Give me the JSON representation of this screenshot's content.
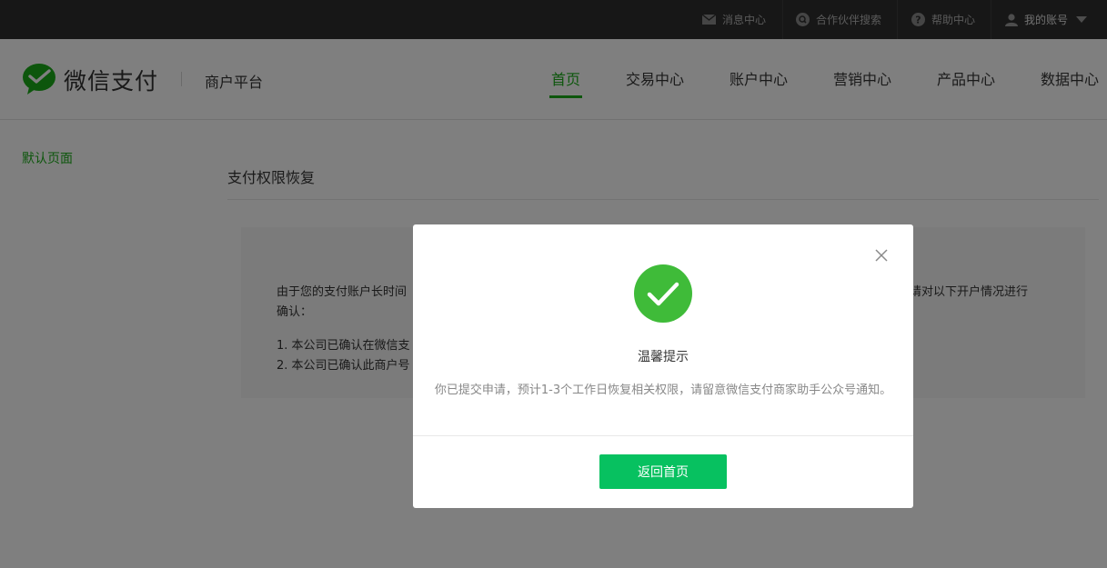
{
  "topbar": {
    "messages": "消息中心",
    "partner_search": "合作伙伴搜索",
    "help": "帮助中心",
    "account": "我的账号"
  },
  "header": {
    "brand": "微信支付",
    "platform": "商户平台",
    "nav": [
      "首页",
      "交易中心",
      "账户中心",
      "营销中心",
      "产品中心",
      "数据中心"
    ],
    "active_index": 0
  },
  "sidebar": {
    "items": [
      {
        "label": "默认页面"
      }
    ]
  },
  "main": {
    "title": "支付权限恢复",
    "notice": {
      "line1_left": "由于您的支付账户长时间",
      "line1_right": "请对以下开户情况进行",
      "line2": "确认：",
      "item1": "1. 本公司已确认在微信支",
      "item2": "2. 本公司已确认此商户号"
    }
  },
  "dialog": {
    "title": "温馨提示",
    "message": "你已提交申请，预计1-3个工作日恢复相关权限，请留意微信支付商家助手公众号通知。",
    "button": "返回首页"
  },
  "colors": {
    "brand_green": "#1aad19",
    "button_green": "#07c160",
    "success_green": "#3fbb39",
    "topbar_bg": "#2e2e2e"
  }
}
